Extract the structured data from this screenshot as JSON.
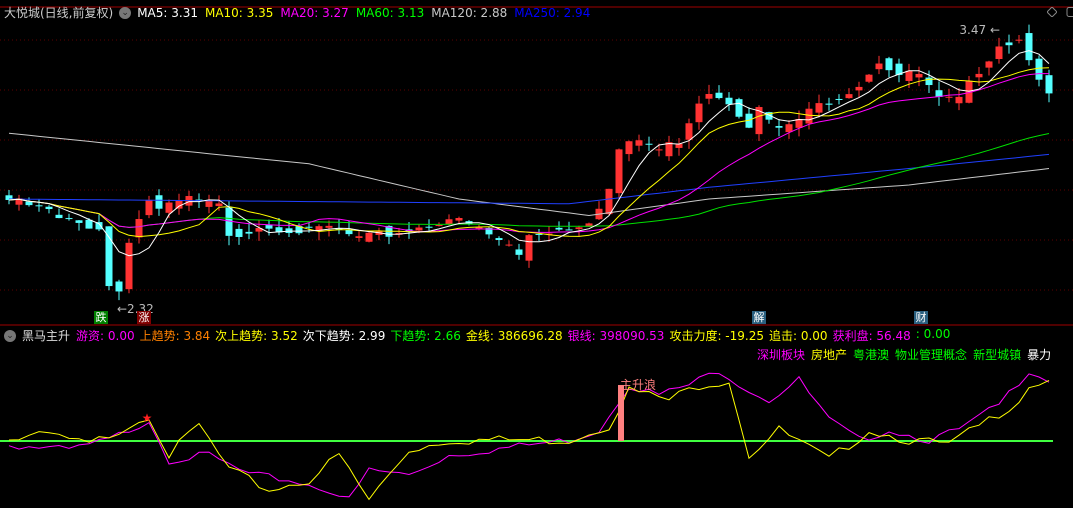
{
  "title": "大悦城(日线,前复权)",
  "ma_legend": [
    {
      "label": "MA5: 3.31",
      "color": "#ffffff"
    },
    {
      "label": "MA10: 3.35",
      "color": "#ffff00"
    },
    {
      "label": "MA20: 3.27",
      "color": "#ff00ff"
    },
    {
      "label": "MA60: 3.13",
      "color": "#00ff00"
    },
    {
      "label": "MA120: 2.88",
      "color": "#c8c8c8"
    },
    {
      "label": "MA250: 2.94",
      "color": "#0000ff"
    }
  ],
  "indicator_name": "黑马主升",
  "indicator_legend": [
    {
      "label": "游资: 0.00",
      "color": "#ff00ff"
    },
    {
      "label": "上趋势: 3.84",
      "color": "#ff8000"
    },
    {
      "label": "次上趋势: 3.52",
      "color": "#ffff00"
    },
    {
      "label": "次下趋势: 2.99",
      "color": "#ffffff"
    },
    {
      "label": "下趋势: 2.66",
      "color": "#00ff00"
    },
    {
      "label": "金线: 386696.28",
      "color": "#ffff00"
    },
    {
      "label": "银线: 398090.53",
      "color": "#ff00ff"
    },
    {
      "label": "攻击力度: -19.25",
      "color": "#ffff00"
    },
    {
      "label": "追击: 0.00",
      "color": "#ffff00"
    },
    {
      "label": "获利盘: 56.48",
      "color": "#ff00ff"
    },
    {
      "label": ": 0.00",
      "color": "#00ff00"
    }
  ],
  "tags": [
    {
      "label": "深圳板块",
      "color": "#ff00ff"
    },
    {
      "label": "房地产",
      "color": "#ffff00"
    },
    {
      "label": "粤港澳",
      "color": "#00ff00"
    },
    {
      "label": "物业管理概念",
      "color": "#00ff00"
    },
    {
      "label": "新型城镇",
      "color": "#00ff00"
    },
    {
      "label": "暴力",
      "color": "#ffffff"
    }
  ],
  "annotations": {
    "high": "3.47",
    "low": "2.32",
    "wave": "主升浪"
  },
  "markers": [
    {
      "label": "跌",
      "bg": "#008000"
    },
    {
      "label": "涨",
      "bg": "#800000"
    },
    {
      "label": "解",
      "bg": "#2a6080"
    },
    {
      "label": "财",
      "bg": "#2a6080"
    }
  ],
  "price_range": [
    2.32,
    3.47
  ],
  "close_keypoints": [
    [
      0,
      2.746
    ],
    [
      4,
      2.7
    ],
    [
      5,
      2.66
    ],
    [
      9,
      2.63
    ],
    [
      10,
      2.38
    ],
    [
      11,
      2.36
    ],
    [
      12,
      2.58
    ],
    [
      14,
      2.75
    ],
    [
      15,
      2.7
    ],
    [
      18,
      2.75
    ],
    [
      21,
      2.72
    ],
    [
      22,
      2.58
    ],
    [
      23,
      2.6
    ],
    [
      25,
      2.64
    ],
    [
      30,
      2.61
    ],
    [
      32,
      2.63
    ],
    [
      35,
      2.58
    ],
    [
      38,
      2.6
    ],
    [
      42,
      2.64
    ],
    [
      44,
      2.67
    ],
    [
      47,
      2.62
    ],
    [
      50,
      2.55
    ],
    [
      51,
      2.51
    ],
    [
      52,
      2.6
    ],
    [
      56,
      2.63
    ],
    [
      58,
      2.66
    ],
    [
      60,
      2.79
    ],
    [
      61,
      2.96
    ],
    [
      63,
      3.0
    ],
    [
      65,
      2.96
    ],
    [
      67,
      3.0
    ],
    [
      69,
      3.17
    ],
    [
      70,
      3.21
    ],
    [
      72,
      3.17
    ],
    [
      74,
      3.07
    ],
    [
      75,
      3.13
    ],
    [
      77,
      3.04
    ],
    [
      79,
      3.09
    ],
    [
      81,
      3.15
    ],
    [
      83,
      3.19
    ],
    [
      85,
      3.24
    ],
    [
      87,
      3.34
    ],
    [
      89,
      3.28
    ],
    [
      91,
      3.28
    ],
    [
      93,
      3.17
    ],
    [
      95,
      3.17
    ],
    [
      97,
      3.3
    ],
    [
      99,
      3.41
    ],
    [
      101,
      3.43
    ],
    [
      102,
      3.36
    ],
    [
      104,
      3.19
    ]
  ],
  "ma120_keypoints": [
    [
      0,
      3.03
    ],
    [
      30,
      2.9
    ],
    [
      45,
      2.75
    ],
    [
      58,
      2.68
    ],
    [
      70,
      2.75
    ],
    [
      90,
      2.81
    ],
    [
      104,
      2.88
    ]
  ],
  "ma250_keypoints": [
    [
      0,
      2.75
    ],
    [
      56,
      2.73
    ],
    [
      70,
      2.8
    ],
    [
      90,
      2.88
    ],
    [
      104,
      2.94
    ]
  ],
  "indicator_series": {
    "silver": [
      [
        0,
        -4
      ],
      [
        6,
        -9
      ],
      [
        10,
        1
      ],
      [
        14,
        21
      ],
      [
        16,
        -19
      ],
      [
        20,
        -14
      ],
      [
        24,
        -34
      ],
      [
        28,
        -39
      ],
      [
        32,
        -49
      ],
      [
        34,
        -59
      ],
      [
        36,
        -29
      ],
      [
        40,
        -34
      ],
      [
        44,
        -14
      ],
      [
        48,
        -9
      ],
      [
        52,
        -4
      ],
      [
        56,
        1
      ],
      [
        59,
        11
      ],
      [
        62,
        56
      ],
      [
        65,
        46
      ],
      [
        68,
        56
      ],
      [
        71,
        71
      ],
      [
        74,
        51
      ],
      [
        76,
        41
      ],
      [
        79,
        61
      ],
      [
        82,
        21
      ],
      [
        85,
        1
      ],
      [
        88,
        11
      ],
      [
        92,
        1
      ],
      [
        95,
        11
      ],
      [
        99,
        36
      ],
      [
        102,
        71
      ],
      [
        104,
        61
      ]
    ],
    "gold": [
      [
        0,
        1
      ],
      [
        4,
        6
      ],
      [
        8,
        -4
      ],
      [
        14,
        26
      ],
      [
        16,
        -14
      ],
      [
        19,
        16
      ],
      [
        22,
        -29
      ],
      [
        26,
        -49
      ],
      [
        30,
        -39
      ],
      [
        33,
        -14
      ],
      [
        36,
        -59
      ],
      [
        40,
        -9
      ],
      [
        44,
        1
      ],
      [
        50,
        1
      ],
      [
        56,
        1
      ],
      [
        60,
        16
      ],
      [
        62,
        51
      ],
      [
        66,
        41
      ],
      [
        69,
        56
      ],
      [
        72,
        61
      ],
      [
        74,
        -14
      ],
      [
        77,
        11
      ],
      [
        82,
        -19
      ],
      [
        86,
        11
      ],
      [
        90,
        1
      ],
      [
        94,
        -4
      ],
      [
        98,
        21
      ],
      [
        101,
        41
      ],
      [
        102,
        56
      ],
      [
        104,
        61
      ]
    ]
  }
}
